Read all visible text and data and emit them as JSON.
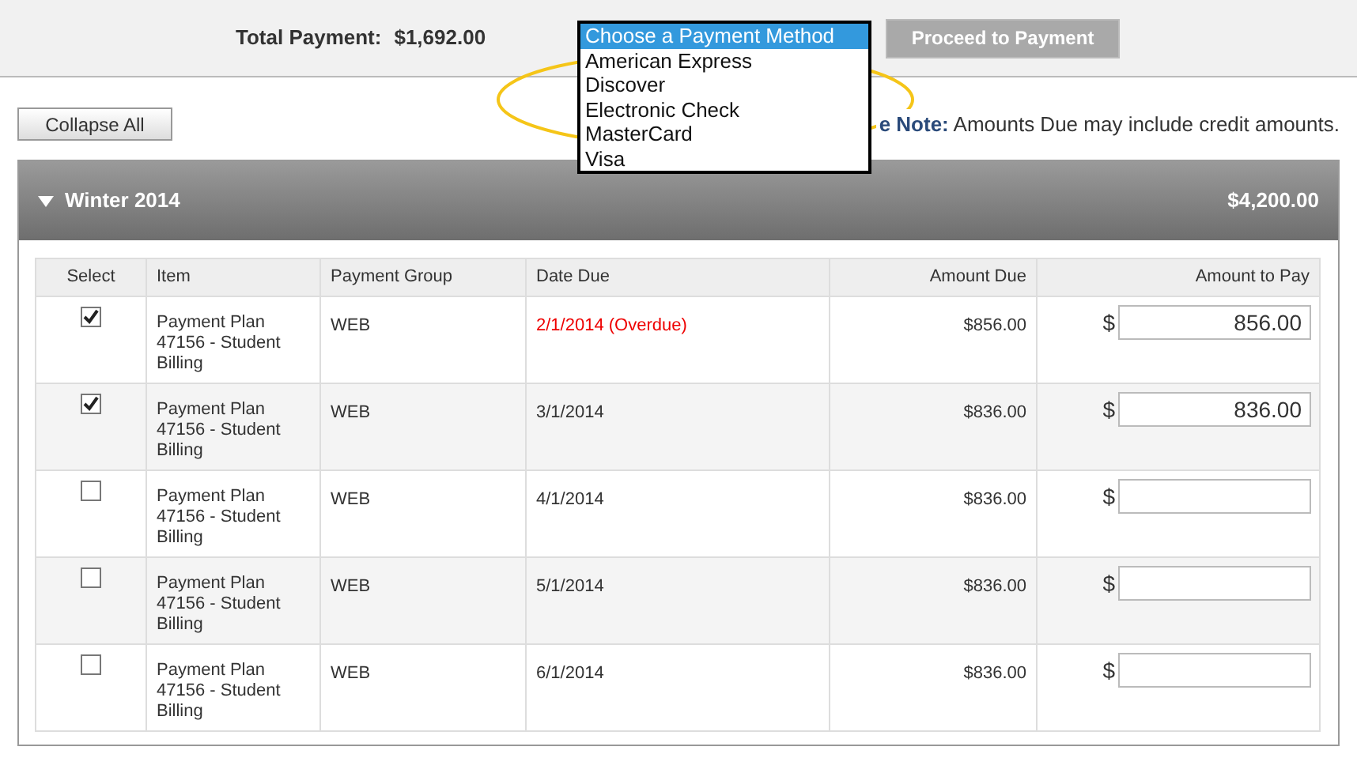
{
  "summary": {
    "label": "Total Payment:",
    "amount": "$1,692.00"
  },
  "payment_method_dropdown": {
    "options": [
      {
        "label": "Choose a Payment Method",
        "selected": true
      },
      {
        "label": "American Express",
        "selected": false
      },
      {
        "label": "Discover",
        "selected": false
      },
      {
        "label": "Electronic Check",
        "selected": false
      },
      {
        "label": "MasterCard",
        "selected": false
      },
      {
        "label": "Visa",
        "selected": false
      }
    ]
  },
  "proceed_button": {
    "label": "Proceed to Payment",
    "disabled": true
  },
  "collapse_button": "Collapse All",
  "note": "**e Note:** Amounts Due may include credit amounts.",
  "term": {
    "title": "Winter 2014",
    "total": "$4,200.00",
    "expanded": true,
    "table": {
      "columns": [
        "Select",
        "Item",
        "Payment Group",
        "Date Due",
        "Amount Due",
        "Amount to Pay"
      ],
      "currency": "$",
      "rows": [
        {
          "checked": true,
          "item": "Payment Plan 47156 - Student Billing",
          "group": "WEB",
          "date_due": "2/1/2014 (Overdue)",
          "overdue": true,
          "amount_due": "$856.00",
          "amount_to_pay": "856.00"
        },
        {
          "checked": true,
          "item": "Payment Plan 47156 - Student Billing",
          "group": "WEB",
          "date_due": "3/1/2014",
          "overdue": false,
          "amount_due": "$836.00",
          "amount_to_pay": "836.00"
        },
        {
          "checked": false,
          "item": "Payment Plan 47156 - Student Billing",
          "group": "WEB",
          "date_due": "4/1/2014",
          "overdue": false,
          "amount_due": "$836.00",
          "amount_to_pay": ""
        },
        {
          "checked": false,
          "item": "Payment Plan 47156 - Student Billing",
          "group": "WEB",
          "date_due": "5/1/2014",
          "overdue": false,
          "amount_due": "$836.00",
          "amount_to_pay": ""
        },
        {
          "checked": false,
          "item": "Payment Plan 47156 - Student Billing",
          "group": "WEB",
          "date_due": "6/1/2014",
          "overdue": false,
          "amount_due": "$836.00",
          "amount_to_pay": ""
        }
      ]
    }
  }
}
